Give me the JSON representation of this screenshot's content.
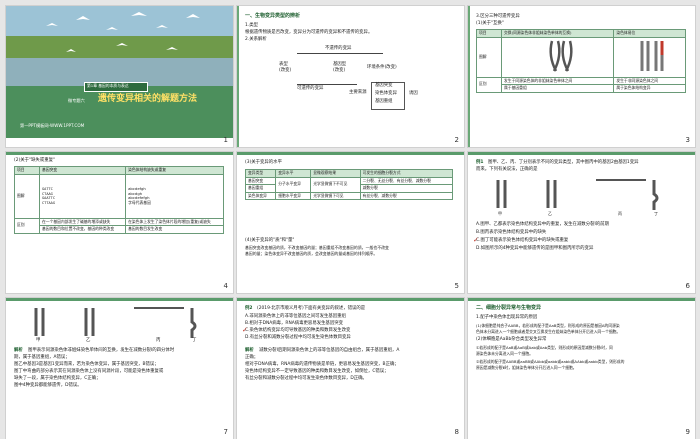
{
  "slides": [
    {
      "num": "1",
      "badge": "第1章 基因的本质与表达",
      "section": "微专题六",
      "title": "遗传变异相关的解题方法",
      "footer": "第一PPT模板网-WWW.1PPT.COM"
    },
    {
      "num": "2",
      "heading": "一、生物变异类型的辨析",
      "l1": "1.类型",
      "l2": "根据遗传物质是否改变，变异分为可遗传的变异和不遗传的变异。",
      "l3": "2.关系解析",
      "d_top": "不遗传的变异",
      "d_left": "表型",
      "d_left2": "(改变)",
      "d_mid": "基因型",
      "d_mid2": "(改变)",
      "d_env": "环境条件(改变)",
      "d_bottom": "可遗传的变异",
      "d_src": "主要来源",
      "d_r1": "基因突变",
      "d_r2": "染色体变异",
      "d_r3": "基因重组",
      "d_r4": "诱因"
    },
    {
      "num": "3",
      "heading": "3.区分三种可遗传变异",
      "sub": "(1)关于\"互换\"",
      "h1": "项目",
      "h2": "交换(同源染色体非姐妹染色单体的互换)",
      "h3": "染色体易位",
      "r1": "图解",
      "r2": "区别",
      "c1": "发生于同源染色体的非姐妹染色单体之间",
      "c2": "发生于非同源染色体之间",
      "c3": "属于基因重组",
      "c4": "属于染色体结构变异"
    },
    {
      "num": "4",
      "heading": "(2)关于\"缺失或重复\"",
      "h1": "项目",
      "h2": "基因突变",
      "h3": "染色体结构缺失或重复",
      "r1": "图解",
      "r2": "区别",
      "seq1": "GATTC",
      "seq2": "CTAAG",
      "seq3": "GAATTC",
      "seq4": "CTTAAG",
      "chr1": "abcdefgh",
      "chr2": "abcdgh",
      "chr3": "abcdefefgh",
      "legend": "字母代表基因",
      "c1": "在一个基因内部发生了碱基的增添或缺失",
      "c2": "在染色体上发生了染色体片段的增加(重复)或缺失",
      "c3": "基因的数目和位置不改变，基因的种类改变",
      "c4": "基因的数目发生改变"
    },
    {
      "num": "5",
      "heading": "(3)关于变异的水平",
      "h1": "变异类型",
      "h2": "变异水平",
      "h3": "显微观察结果",
      "h4": "可发生的细胞分裂方式",
      "r1": "基因突变",
      "r2": "基因重组",
      "r3": "染色体变异",
      "v1": "分子水平变异",
      "v2": "光学显微镜下不可见",
      "v3": "二分裂、无丝分裂、有丝分裂、减数分裂",
      "v4": "减数分裂",
      "v5": "细胞水平变异",
      "v6": "光学显微镜下可见",
      "v7": "有丝分裂、减数分裂",
      "p1": "(4)关于变异的\"质\"和\"量\"",
      "p2": "基因突变改变基因的质，不改变基因的量；基因重组不改变基因的质，一般也不改变",
      "p3": "基因的量；染色体变异不改变基因的质，会改变基因的量或基因的排列顺序。"
    },
    {
      "num": "6",
      "label": "例1",
      "q1": "图甲、乙、丙、丁分别表示不同的变异类型，其中图丙中的基因2由基因1变异",
      "q2": "而来。下列有关说法，正确的是",
      "f1": "甲",
      "f2": "乙",
      "f3": "丙",
      "f4": "丁",
      "oA": "A.图甲、乙都表示染色体结构变异中的重复，发生在减数分裂Ⅰ的前期",
      "oB": "B.图丙表示染色体结构变异中的缺失",
      "oC": "C.图丁可能表示染色体结构变异中的缺失或重复",
      "oD": "D.如图所示的4种变异中能够遗传的是图甲和图丙所示的变异"
    },
    {
      "num": "7",
      "f1": "甲",
      "f2": "乙",
      "f3": "丙",
      "f4": "丁",
      "a0": "解析",
      "a1": "图甲表示同源染色体非姐妹染色单体间的互换，发生在减数分裂Ⅰ的四分体时",
      "a2": "期，属于基因重组，A错误；",
      "a3": "图乙中基因3是基因1变异而来，若为染色体变异，属于基因突变，B错误；",
      "a4": "图丁中弯曲的部分表示其在同源染色体上没有同源片段，可能是染色体重复或",
      "a5": "缺失了一段，属于染色体结构变异，C正确；",
      "a6": "图中4种变异都能够遗传，D错误。"
    },
    {
      "num": "8",
      "label": "例2",
      "q1": "(2019·北京市顺义月考)下面有关变异的叙述，错误的是",
      "oA": "A.非同源染色体上的非等位基因之间可发生基因重组",
      "oB": "B.相对于DNA病毒，RNA病毒更容易发生基因突变",
      "oC": "C.染色体结构变异均可导致基因的种类和数目发生改变",
      "oD": "D.有丝分裂和减数分裂过程中均可发生染色体数目变异",
      "a0": "解析",
      "a1": "减数分裂Ⅰ后期同源染色体上的非等位基因的自由组合，属于基因重组，A",
      "a2": "正确；",
      "a3": "相对于DNA病毒，RNA病毒的遗传物质是单链，更容易发生基因突变，B正确；",
      "a4": "染色体结构变异不一定导致基因的种类和数目发生改变，如倒位，C错误；",
      "a5": "有丝分裂和减数分裂过程中均可发生染色体数目变异，D正确。"
    },
    {
      "num": "9",
      "heading": "二、细胞分裂异常与生物变异",
      "l1": "1.配子中染色体出现异常的原因",
      "l2": "(1)体细胞是纯合子AABB，若形成的配子是AaB类型，则形成的原因是基因A的同源染",
      "l3": "色体未分离进入一个细胞或者是交叉互换发生在姐妹染色单体分开后进入同一个细胞。",
      "l4": "(2)体细胞是AaBb杂合类型发生异常",
      "l5": "①若形成的配子是AaB或AaB或Aab或Aab类型，则形成的原因是减数分裂Ⅰ时，同",
      "l6": "源染色体未分离进入同一个细胞。",
      "l7": "②若形成的配子是AABB或aaBB或AAbb或aabb或aabb或AAbb或aabb类型，则形成的",
      "l8": "原因是减数分裂Ⅱ时，姐妹染色单体分开后进入同一个细胞。"
    }
  ],
  "colors": {
    "accent": "#5a9b6b",
    "title_red": "#d4261d",
    "panel_green": "#cfe6d3"
  }
}
